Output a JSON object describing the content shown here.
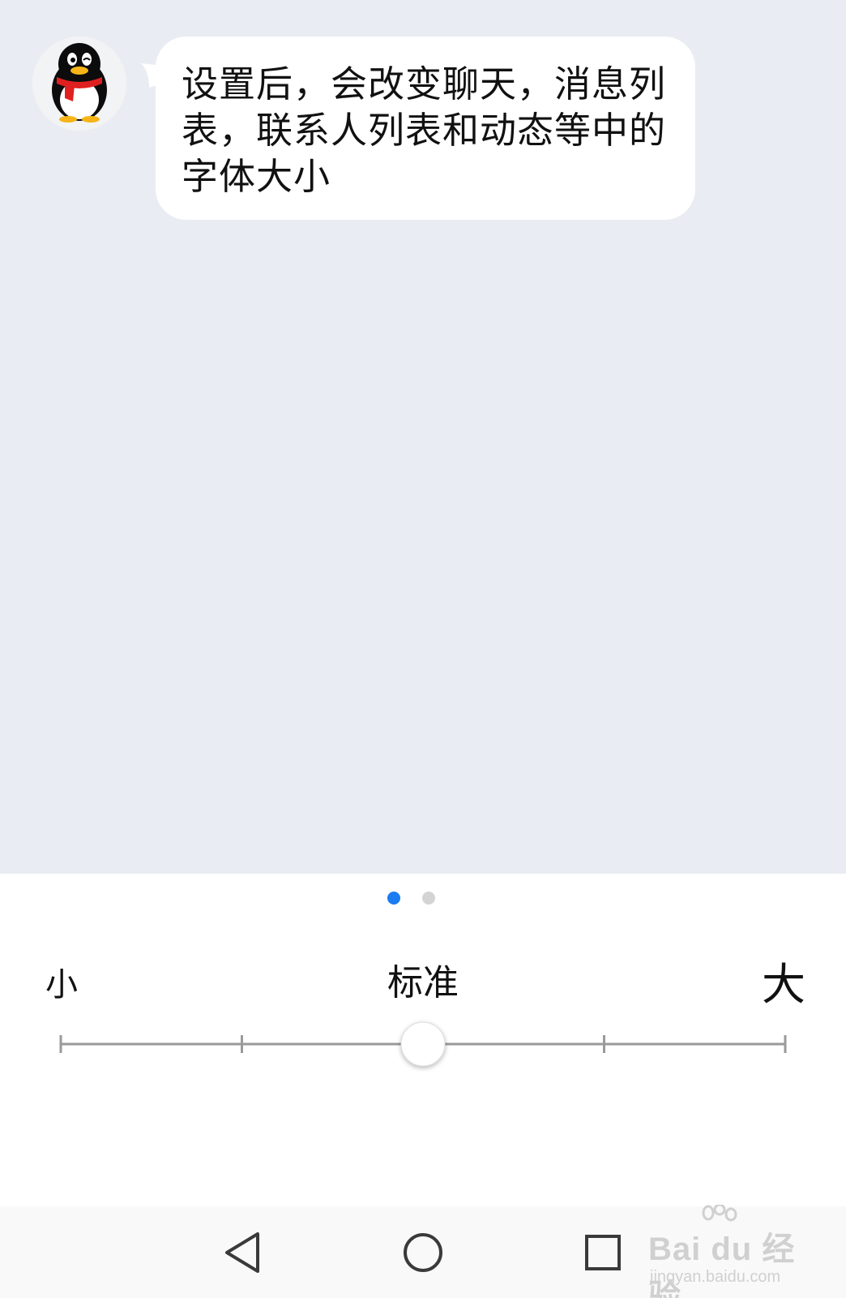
{
  "preview": {
    "message_text": "设置后，会改变聊天，消息列表，联系人列表和动态等中的字体大小",
    "avatar_icon": "qq-penguin-icon",
    "background_color": "#e9ecf2"
  },
  "pager": {
    "total_pages": 2,
    "active_page": 1,
    "active_color": "#1a7cf0",
    "inactive_color": "#d4d4d4"
  },
  "font_size": {
    "small_label": "小",
    "current_label": "标准",
    "large_label": "大",
    "levels": 5,
    "selected_level": 3
  },
  "navbar": {
    "back_icon": "triangle-back-icon",
    "home_icon": "circle-home-icon",
    "recent_icon": "square-recents-icon"
  },
  "watermark": {
    "brand": "Bai du 经验",
    "url": "jingyan.baidu.com"
  }
}
